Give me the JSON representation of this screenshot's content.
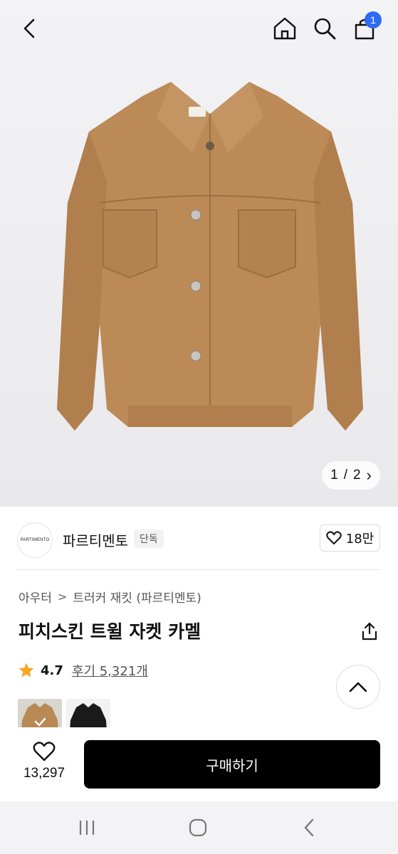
{
  "header": {
    "cart_count": "1",
    "icons": [
      "back-icon",
      "home-icon",
      "search-icon",
      "cart-icon"
    ]
  },
  "gallery": {
    "pager_current": "1",
    "pager_separator": "/",
    "pager_total": "2",
    "pager_arrow": "›"
  },
  "brand": {
    "logo_text": "PARTIMENTO",
    "name": "파르티멘토",
    "badge": "단독",
    "likes": "18만"
  },
  "breadcrumb": {
    "category": "아우터",
    "separator": ">",
    "subcategory": "트러커 재킷 (파르티멘토)"
  },
  "product": {
    "title": "피치스킨 트윌 자켓 카멜",
    "rating": "4.7",
    "reviews": "후기 5,321개"
  },
  "swatches": [
    {
      "name": "camel",
      "color": "#b88954"
    },
    {
      "name": "black",
      "color": "#1a1a1a"
    }
  ],
  "bottom": {
    "like_count": "13,297",
    "buy_label": "구매하기"
  },
  "colors": {
    "accent_badge": "#2f6bf2",
    "star": "#f5a623",
    "buy_button": "#000000"
  }
}
